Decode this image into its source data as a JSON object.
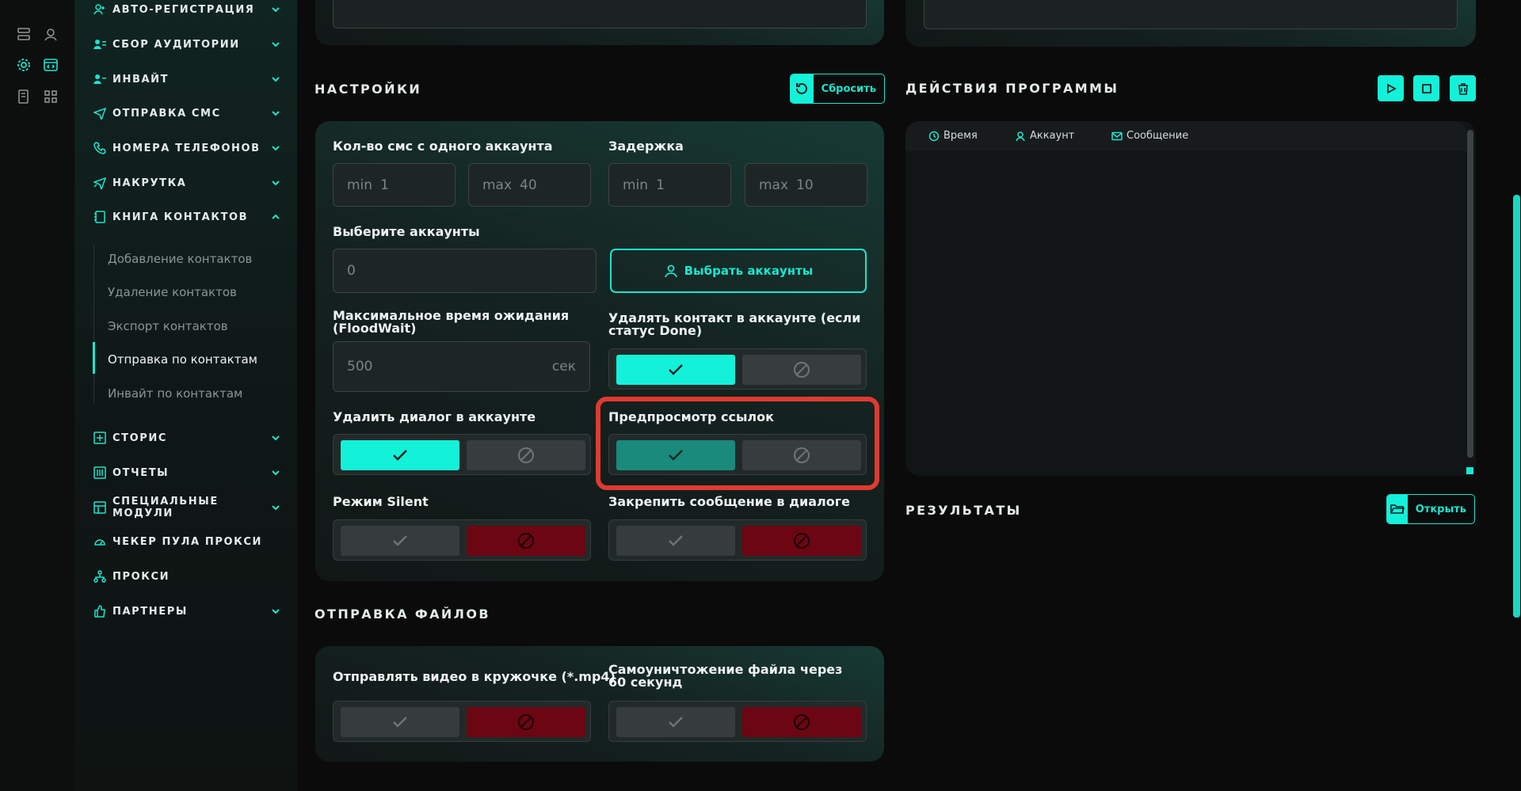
{
  "nav": [
    {
      "label": "АВТО-РЕГИСТРАЦИЯ",
      "icon": "user-plus-icon"
    },
    {
      "label": "СБОР АУДИТОРИИ",
      "icon": "users-icon"
    },
    {
      "label": "ИНВАЙТ",
      "icon": "user-add-icon"
    },
    {
      "label": "ОТПРАВКА СМС",
      "icon": "send-icon"
    },
    {
      "label": "НОМЕРА ТЕЛЕФОНОВ",
      "icon": "phone-icon"
    },
    {
      "label": "НАКРУТКА",
      "icon": "boost-send-icon"
    },
    {
      "label": "КНИГА КОНТАКТОВ",
      "icon": "contacts-book-icon"
    },
    {
      "label": "СТОРИС",
      "icon": "stories-plus-icon"
    },
    {
      "label": "ОТЧЕТЫ",
      "icon": "report-icon"
    },
    {
      "label": "СПЕЦИАЛЬНЫЕ МОДУЛИ",
      "icon": "modules-icon"
    },
    {
      "label": "ЧЕКЕР ПУЛА ПРОКСИ",
      "icon": "gauge-icon"
    },
    {
      "label": "ПРОКСИ",
      "icon": "network-icon"
    },
    {
      "label": "ПАРТНЕРЫ",
      "icon": "thumbs-up-icon"
    }
  ],
  "contacts_sub": [
    "Добавление контактов",
    "Удаление контактов",
    "Экспорт контактов",
    "Отправка по контактам",
    "Инвайт по контактам"
  ],
  "settings": {
    "title": "НАСТРОЙКИ",
    "reset_label": "Сбросить",
    "sms_per_account": {
      "label": "Кол-во смс с одного аккаунта",
      "min_prefix": "min",
      "min": "1",
      "max_prefix": "max",
      "max": "40"
    },
    "delay": {
      "label": "Задержка",
      "min_prefix": "min",
      "min": "1",
      "max_prefix": "max",
      "max": "10"
    },
    "accounts": {
      "label": "Выберите аккаунты",
      "value": "0",
      "button": "Выбрать аккаунты"
    },
    "floodwait": {
      "label": "Максимальное время ожидания (FloodWait)",
      "value": "500",
      "unit": "сек"
    },
    "delete_contact": {
      "label": "Удалять контакт в аккаунте (если статус Done)"
    },
    "delete_dialog": {
      "label": "Удалить диалог в аккаунте"
    },
    "link_preview": {
      "label": "Предпросмотр ссылок"
    },
    "silent": {
      "label": "Режим Silent"
    },
    "pin_message": {
      "label": "Закрепить сообщение в диалоге"
    }
  },
  "files": {
    "title": "ОТПРАВКА ФАЙЛОВ",
    "round_video": {
      "label": "Отправлять видео в кружочке (*.mp4)"
    },
    "self_destruct": {
      "label": "Самоуничтожение файла через 60 секунд"
    }
  },
  "actions": {
    "title": "ДЕЙСТВИЯ ПРОГРАММЫ",
    "columns": [
      "Время",
      "Аккаунт",
      "Сообщение"
    ]
  },
  "results": {
    "title": "РЕЗУЛЬТАТЫ",
    "open_label": "Открыть"
  },
  "colors": {
    "accent": "#14f1d9",
    "highlight": "#e03a30",
    "negative": "#6b0612"
  }
}
